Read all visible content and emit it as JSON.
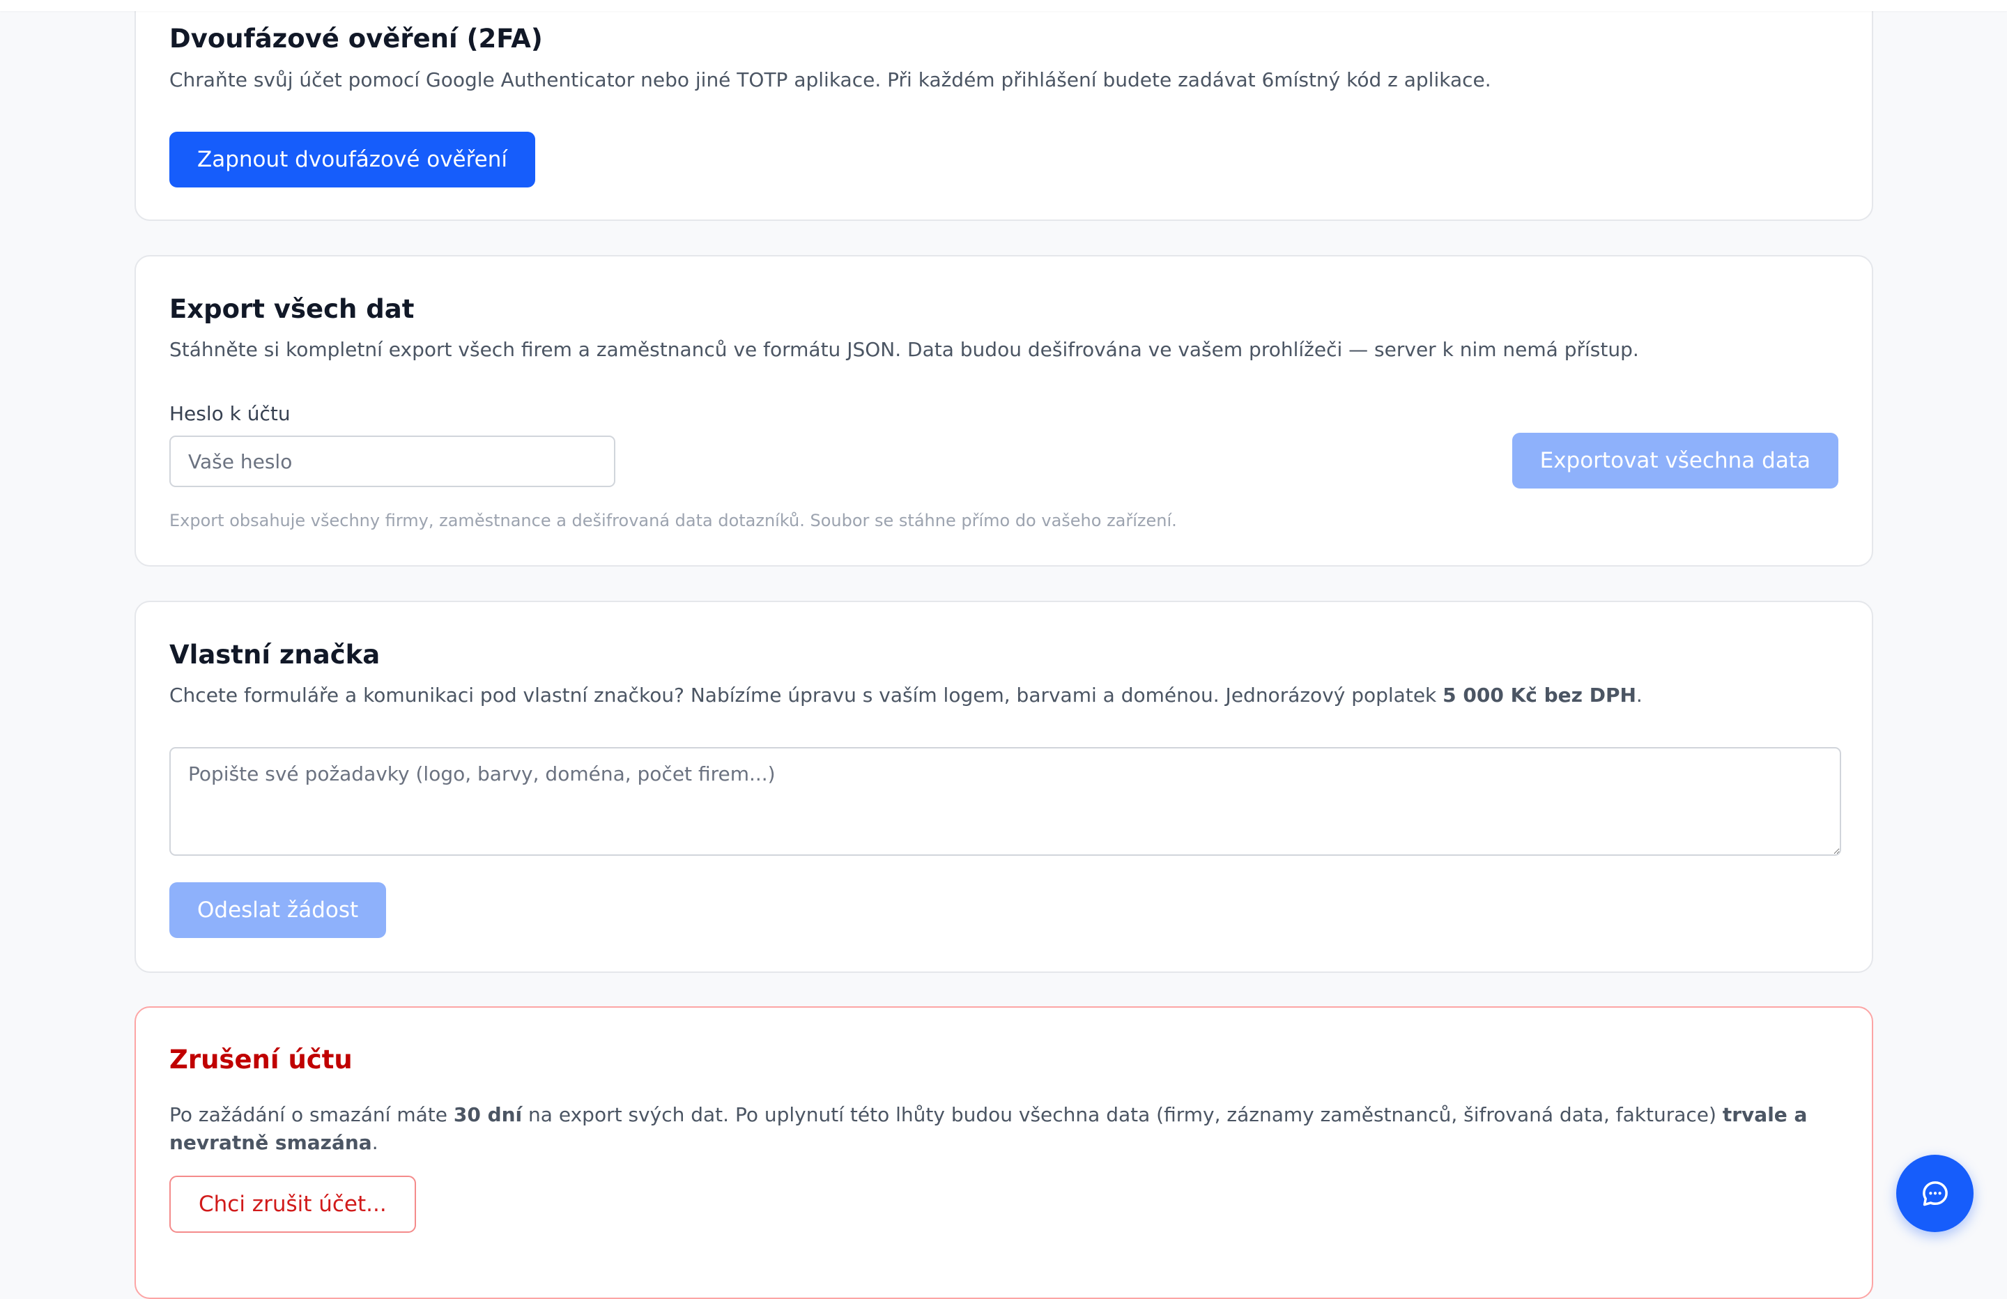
{
  "twofa": {
    "title": "Dvoufázové ověření (2FA)",
    "description": "Chraňte svůj účet pomocí Google Authenticator nebo jiné TOTP aplikace. Při každém přihlášení budete zadávat 6místný kód z aplikace.",
    "enable_button": "Zapnout dvoufázové ověření"
  },
  "export": {
    "title": "Export všech dat",
    "description": "Stáhněte si kompletní export všech firem a zaměstnanců ve formátu JSON. Data budou dešifrována ve vašem prohlížeči — server k nim nemá přístup.",
    "password_label": "Heslo k účtu",
    "password_value": "",
    "password_placeholder": "Vaše heslo",
    "export_button": "Exportovat všechna data",
    "hint": "Export obsahuje všechny firmy, zaměstnance a dešifrovaná data dotazníků. Soubor se stáhne přímo do vašeho zařízení."
  },
  "branding": {
    "title": "Vlastní značka",
    "description_before": "Chcete formuláře a komunikaci pod vlastní značkou? Nabízíme úpravu s vaším logem, barvami a doménou. Jednorázový poplatek ",
    "description_price": "5 000 Kč bez DPH",
    "description_after": ".",
    "request_value": "",
    "request_placeholder": "Popište své požadavky (logo, barvy, doména, počet firem...)",
    "submit_button": "Odeslat žádost"
  },
  "cancel_account": {
    "title": "Zrušení účtu",
    "description_1": "Po zažádání o smazání máte ",
    "description_days": "30 dní",
    "description_2": " na export svých dat. Po uplynutí této lhůty budou všechna data (firmy, záznamy zaměstnanců, šifrovaná data, fakturace) ",
    "description_bold": "trvale a nevratně smazána",
    "description_3": ".",
    "cancel_button": "Chci zrušit účet..."
  },
  "chat": {
    "icon": "chat-bubble-icon"
  },
  "colors": {
    "primary": "#165dfb",
    "primary_disabled": "#8eb1fb",
    "danger": "#c00000",
    "danger_border": "#fca5a5"
  }
}
